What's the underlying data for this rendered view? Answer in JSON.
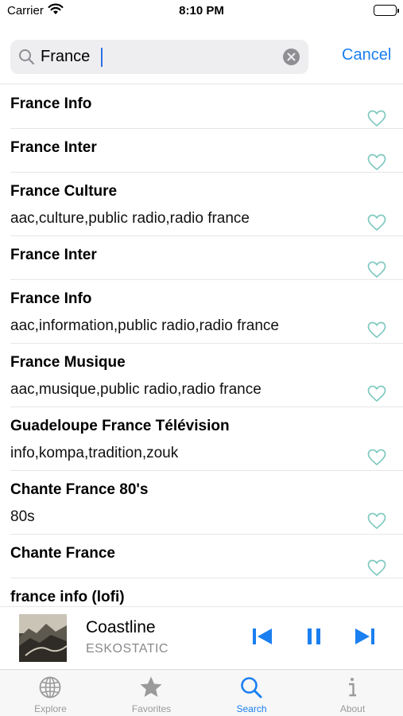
{
  "status_bar": {
    "carrier": "Carrier",
    "time": "8:10 PM"
  },
  "search": {
    "value": "France",
    "cancel_label": "Cancel"
  },
  "colors": {
    "accent": "#1a7ff0",
    "heart": "#7ec9bf"
  },
  "results": [
    {
      "title": "France Info",
      "tags": ""
    },
    {
      "title": "France Inter",
      "tags": ""
    },
    {
      "title": "France Culture",
      "tags": "aac,culture,public radio,radio france"
    },
    {
      "title": "France Inter",
      "tags": ""
    },
    {
      "title": "France Info",
      "tags": "aac,information,public radio,radio france"
    },
    {
      "title": "France Musique",
      "tags": "aac,musique,public radio,radio france"
    },
    {
      "title": "Guadeloupe France Télévision",
      "tags": "info,kompa,tradition,zouk"
    },
    {
      "title": "Chante France 80's",
      "tags": "80s"
    },
    {
      "title": "Chante France",
      "tags": ""
    },
    {
      "title": "france info (lofi)",
      "tags": ""
    }
  ],
  "now_playing": {
    "title": "Coastline",
    "artist": "ESKOSTATIC"
  },
  "tabs": [
    {
      "label": "Explore",
      "icon": "globe-icon",
      "active": false
    },
    {
      "label": "Favorites",
      "icon": "star-icon",
      "active": false
    },
    {
      "label": "Search",
      "icon": "search-icon",
      "active": true
    },
    {
      "label": "About",
      "icon": "info-icon",
      "active": false
    }
  ]
}
